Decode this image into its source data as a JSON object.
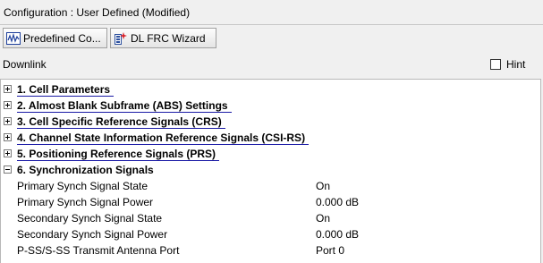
{
  "config": {
    "title": "Configuration : User Defined (Modified)"
  },
  "toolbar": {
    "predefined_label": "Predefined Co...",
    "wizard_label": "DL FRC Wizard"
  },
  "panel": {
    "label": "Downlink",
    "hint_label": "Hint",
    "hint_checked": false
  },
  "categories": [
    {
      "label": "1. Cell Parameters",
      "expanded": false
    },
    {
      "label": "2. Almost Blank Subframe (ABS) Settings",
      "expanded": false
    },
    {
      "label": "3. Cell Specific Reference Signals (CRS)",
      "expanded": false
    },
    {
      "label": "4. Channel State Information Reference Signals (CSI-RS)",
      "expanded": false
    },
    {
      "label": "5. Positioning Reference Signals (PRS)",
      "expanded": false
    },
    {
      "label": "6. Synchronization Signals",
      "expanded": true
    }
  ],
  "properties": [
    {
      "name": "Primary Synch Signal State",
      "value": "On"
    },
    {
      "name": "Primary Synch Signal Power",
      "value": "0.000 dB"
    },
    {
      "name": "Secondary Synch Signal State",
      "value": "On"
    },
    {
      "name": "Secondary Synch Signal Power",
      "value": "0.000 dB"
    },
    {
      "name": "P-SS/S-SS Transmit Antenna Port",
      "value": "Port 0"
    }
  ]
}
